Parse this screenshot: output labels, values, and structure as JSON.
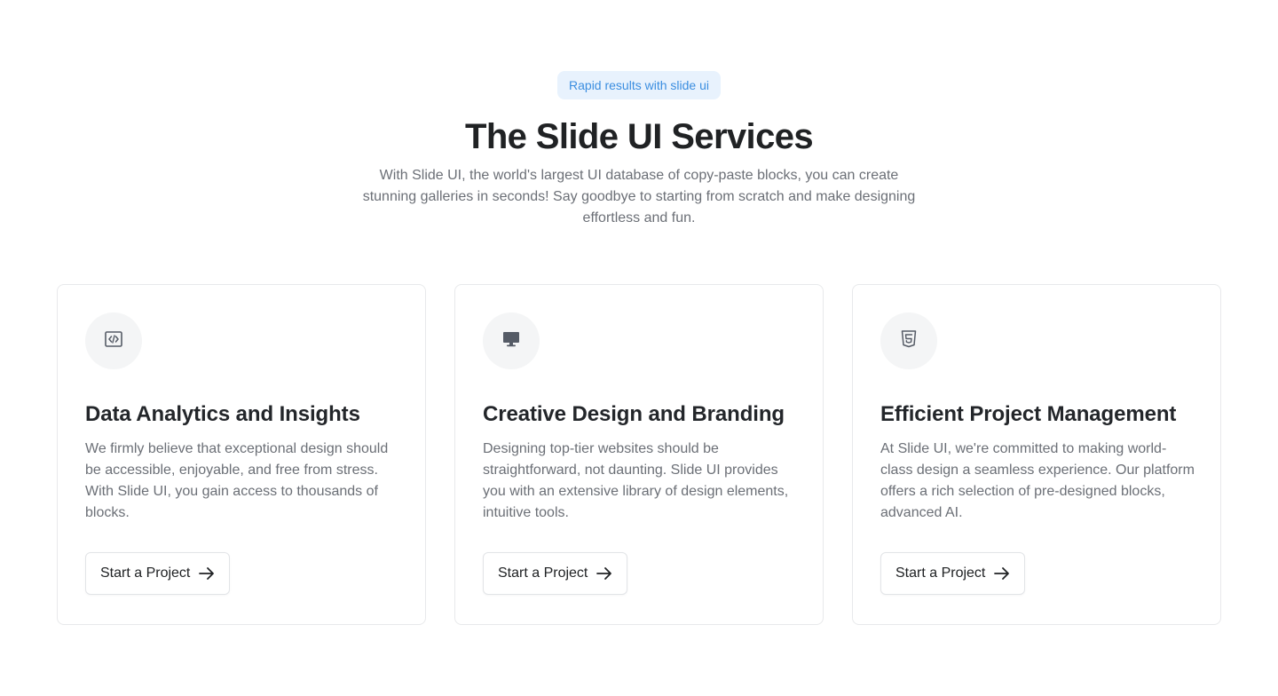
{
  "hero": {
    "badge": "Rapid results with slide ui",
    "title": "The Slide UI Services",
    "subtitle": "With Slide UI, the world's largest UI database of copy-paste blocks, you can create stunning galleries in seconds! Say goodbye to starting from scratch and make designing effortless and fun."
  },
  "cards": [
    {
      "icon": "code-icon",
      "title": "Data Analytics and Insights",
      "text": "We firmly believe that exceptional design should be accessible, enjoyable, and free from stress. With Slide UI, you gain access to thousands of blocks.",
      "button_label": "Start a Project"
    },
    {
      "icon": "monitor-icon",
      "title": "Creative Design and Branding",
      "text": "Designing top-tier websites should be straightforward, not daunting. Slide UI provides you with an extensive library of design elements, intuitive tools.",
      "button_label": "Start a Project"
    },
    {
      "icon": "html5-icon",
      "title": "Efficient Project Management",
      "text": "At Slide UI, we're committed to making world-class design a seamless experience. Our platform offers a rich selection of pre-designed blocks, advanced AI.",
      "button_label": "Start a Project"
    }
  ],
  "colors": {
    "badge_bg": "#e8f2fd",
    "badge_text": "#3b8ee0",
    "title": "#202224",
    "body_text": "#6b6f76",
    "card_border": "#e8e9eb"
  }
}
